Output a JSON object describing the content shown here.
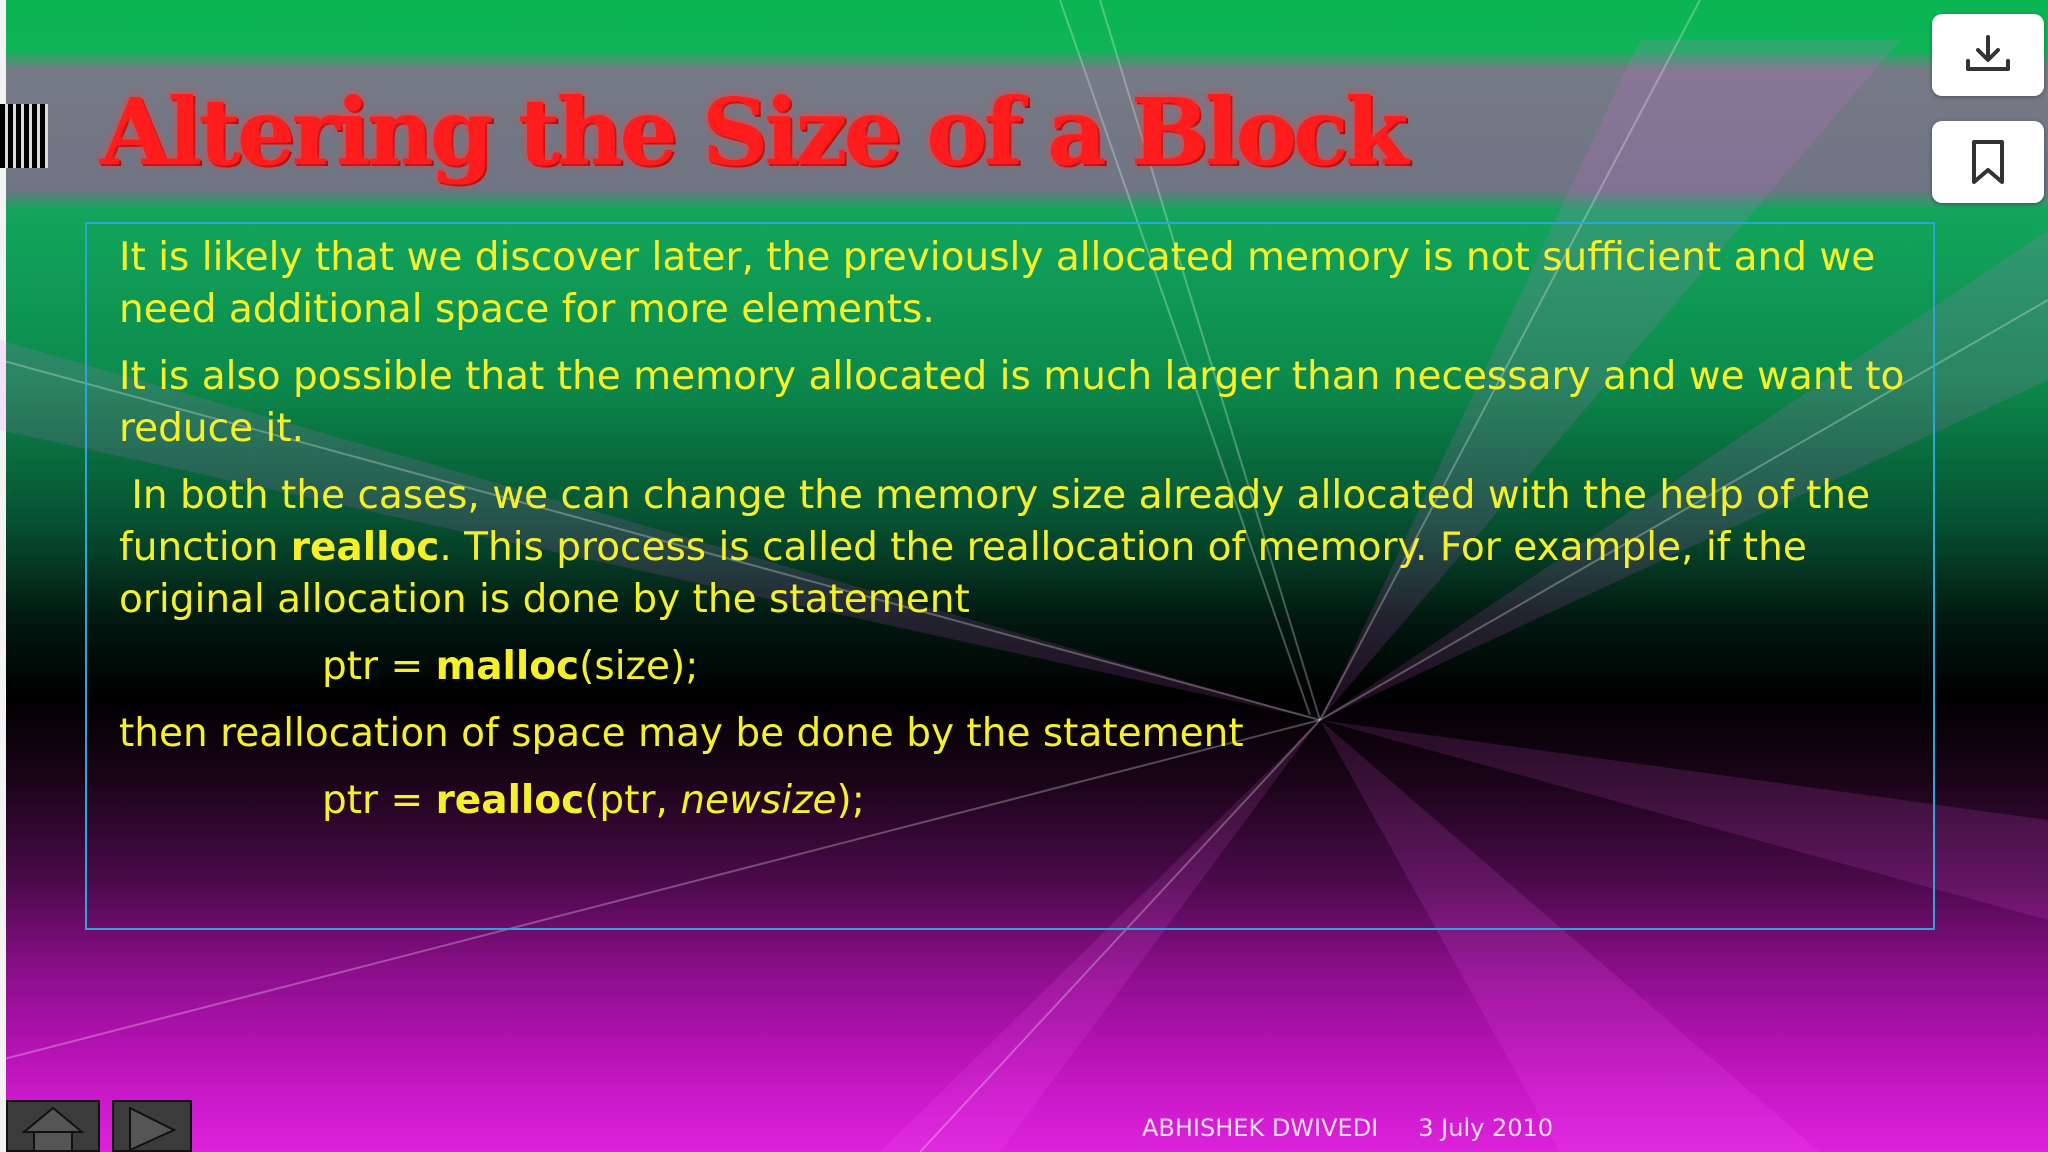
{
  "slide": {
    "title": "Altering the Size of a Block",
    "paragraph_1": "It is likely that we discover later, the previously allocated memory is not sufficient and we need additional space for more elements.",
    "paragraph_2": "It is also possible that the memory allocated is much larger than necessary and we want to reduce it.",
    "paragraph_3_before": "In both the cases, we can change the memory size already allocated with the help of the function ",
    "paragraph_3_keyword": "realloc",
    "paragraph_3_after": ".  This process is called the reallocation of memory.  For example, if the original allocation is done by the statement",
    "code_1": {
      "prefix": "ptr = ",
      "function": "malloc",
      "args": "(size);"
    },
    "paragraph_4": "then reallocation of space may be done by the statement",
    "code_2": {
      "prefix": "ptr = ",
      "function": "realloc",
      "args_open": "(ptr, ",
      "arg_italic": "newsize",
      "args_close": ");"
    },
    "footer": {
      "author": "ABHISHEK DWIVEDI",
      "date": "3 July 2010"
    }
  },
  "toolbar": {
    "download_icon": "download-icon",
    "bookmark_icon": "bookmark-icon"
  },
  "navigation": {
    "home_icon": "home-icon",
    "next_icon": "play-next-icon"
  },
  "colors": {
    "title": "#ff1c1c",
    "body_text": "#f6f02a",
    "box_border": "#2aa6d8",
    "top_band": "#0ab552",
    "bottom_band": "#dc22db"
  }
}
